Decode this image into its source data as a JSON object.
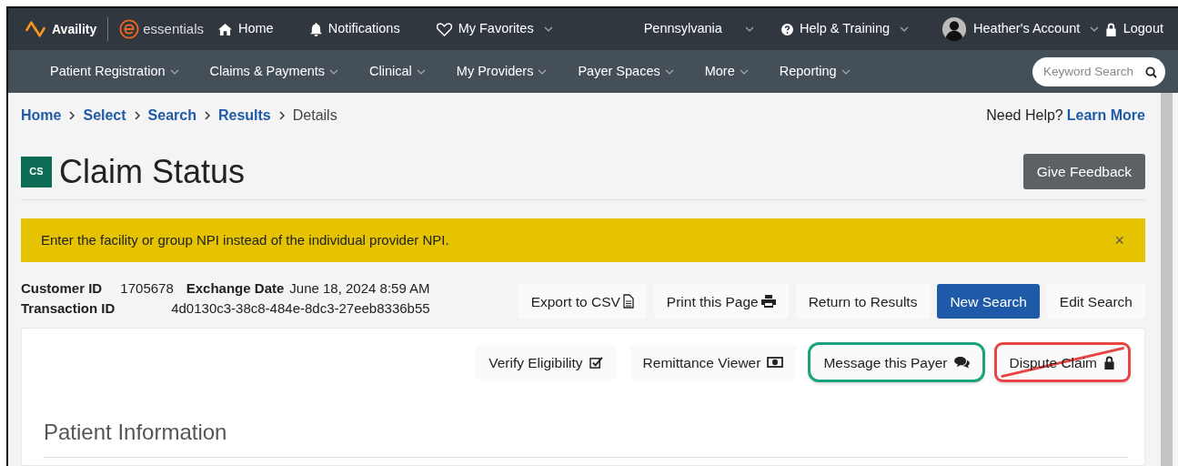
{
  "top_nav": {
    "brand": "Availity",
    "product": "essentials",
    "items": [
      {
        "kind": "home",
        "label": "Home",
        "dropdown": false
      },
      {
        "kind": "bell",
        "label": "Notifications",
        "dropdown": false
      },
      {
        "kind": "heart",
        "label": "My Favorites",
        "dropdown": true
      },
      {
        "kind": "region",
        "label": "Pennsylvania",
        "dropdown": true
      },
      {
        "kind": "help",
        "label": "Help & Training",
        "dropdown": true
      },
      {
        "kind": "account",
        "label": "Heather's Account",
        "dropdown": true
      },
      {
        "kind": "lock",
        "label": "Logout",
        "dropdown": false
      }
    ]
  },
  "main_nav": {
    "items": [
      "Patient Registration",
      "Claims & Payments",
      "Clinical",
      "My Providers",
      "Payer Spaces",
      "More",
      "Reporting"
    ],
    "search": {
      "placeholder": "Keyword Search"
    }
  },
  "breadcrumb": [
    {
      "label": "Home",
      "link": true
    },
    {
      "label": "Select",
      "link": true
    },
    {
      "label": "Search",
      "link": true
    },
    {
      "label": "Results",
      "link": true
    },
    {
      "label": "Details",
      "link": false
    }
  ],
  "help": {
    "text": "Need Help?",
    "link": "Learn More"
  },
  "page": {
    "badge": "CS",
    "title": "Claim Status",
    "feedback_button": "Give Feedback"
  },
  "alert": {
    "text": "Enter the facility or group NPI instead of the individual provider NPI.",
    "close": "×"
  },
  "details": [
    {
      "label": "Customer ID",
      "value": "1705678"
    },
    {
      "label": "Exchange Date",
      "value": "June 18, 2024 8:59 AM"
    },
    {
      "label": "Transaction ID",
      "value": "4d0130c3-38c8-484e-8dc3-27eeb8336b55"
    }
  ],
  "toolbar": [
    {
      "label": "Export to CSV",
      "kind": "file",
      "primary": false
    },
    {
      "label": "Print this Page",
      "kind": "print",
      "primary": false
    },
    {
      "label": "Return to Results",
      "kind": "none",
      "primary": false
    },
    {
      "label": "New Search",
      "kind": "none",
      "primary": true
    },
    {
      "label": "Edit Search",
      "kind": "none",
      "primary": false
    }
  ],
  "actions": [
    {
      "label": "Verify Eligibility",
      "kind": "check"
    },
    {
      "label": "Remittance Viewer",
      "kind": "money"
    },
    {
      "label": "Message this Payer",
      "kind": "chat",
      "highlighted": true,
      "crossed_out": false
    },
    {
      "label": "Dispute Claim",
      "kind": "lock",
      "highlighted": true,
      "crossed_out": true
    }
  ],
  "section_title": "Patient Information"
}
